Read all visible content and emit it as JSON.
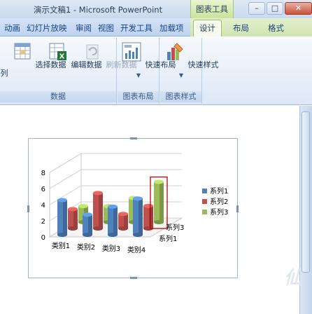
{
  "window": {
    "title": "演示文稿1 - Microsoft PowerPoint",
    "context_label": "图表工具"
  },
  "tabs": [
    "动画",
    "幻灯片放映",
    "审阅",
    "视图",
    "开发工具",
    "加载项",
    "设计",
    "布局",
    "格式"
  ],
  "active_tab": "设计",
  "ribbon": {
    "groups": [
      {
        "label": "数据",
        "buttons": [
          {
            "label": "列",
            "icon": "switch-row-column-icon",
            "enabled": true
          },
          {
            "label": "选择数据",
            "icon": "select-data-icon",
            "enabled": true
          },
          {
            "label": "编辑数据",
            "icon": "edit-data-icon",
            "enabled": true
          },
          {
            "label": "刷新数据",
            "icon": "refresh-data-icon",
            "enabled": false
          }
        ]
      },
      {
        "label": "图表布局",
        "buttons": [
          {
            "label": "快速布局",
            "icon": "quick-layout-icon",
            "enabled": true
          }
        ]
      },
      {
        "label": "图表样式",
        "buttons": [
          {
            "label": "快速样式",
            "icon": "quick-styles-icon",
            "enabled": true
          }
        ]
      }
    ]
  },
  "chart_data": {
    "type": "bar",
    "subtype": "3d-column",
    "categories": [
      "类别1",
      "类别2",
      "类别3",
      "类别4"
    ],
    "series": [
      {
        "name": "系列1",
        "values": [
          4.3,
          2.5,
          3.5,
          4.5
        ],
        "color": "#4f81bd"
      },
      {
        "name": "系列2",
        "values": [
          2.4,
          4.4,
          1.8,
          2.8
        ],
        "color": "#c0504d"
      },
      {
        "name": "系列3",
        "values": [
          2,
          2,
          3,
          5
        ],
        "color": "#9bbb59"
      }
    ],
    "depth_labels": [
      "系列1",
      "系列3"
    ],
    "y_ticks": [
      "0",
      "2",
      "4",
      "6",
      "8"
    ],
    "ylim": [
      0,
      8
    ],
    "legend_position": "right",
    "highlight": {
      "series": "系列3",
      "category": "类别4"
    }
  },
  "colors": {
    "accent_context": "#9bbb59",
    "ribbon_text": "#15428b",
    "highlight_box": "#c00000"
  }
}
